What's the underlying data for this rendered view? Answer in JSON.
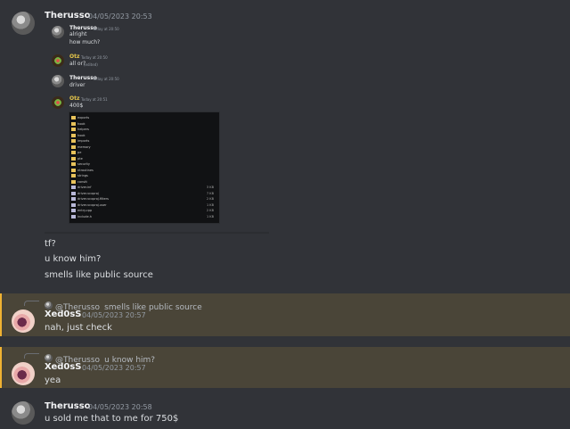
{
  "main_message": {
    "author": "Therusso",
    "timestamp": "04/05/2023 20:53"
  },
  "embedded_chat": [
    {
      "author": "Therusso",
      "time": "Today at 20:50",
      "lines": [
        "alright",
        "how much?"
      ]
    },
    {
      "author": "Otz",
      "time": "Today at 20:50",
      "lines": [
        "all or?"
      ],
      "edited": "(edited)"
    },
    {
      "author": "Therusso",
      "time": "Today at 20:50",
      "lines": [
        "driver"
      ]
    },
    {
      "author": "Otz",
      "time": "Today at 20:51",
      "lines": [
        "400$"
      ]
    }
  ],
  "file_list": [
    {
      "name": "exports",
      "type": "folder",
      "size": ""
    },
    {
      "name": "hook",
      "type": "folder",
      "size": ""
    },
    {
      "name": "helpers",
      "type": "folder",
      "size": ""
    },
    {
      "name": "hook",
      "type": "folder",
      "size": ""
    },
    {
      "name": "imports",
      "type": "folder",
      "size": ""
    },
    {
      "name": "memory",
      "type": "folder",
      "size": ""
    },
    {
      "name": "pe",
      "type": "folder",
      "size": ""
    },
    {
      "name": "pte",
      "type": "folder",
      "size": ""
    },
    {
      "name": "security",
      "type": "folder",
      "size": ""
    },
    {
      "name": "ntroutines",
      "type": "folder",
      "size": ""
    },
    {
      "name": "strings",
      "type": "folder",
      "size": ""
    },
    {
      "name": "constt",
      "type": "folder",
      "size": ""
    },
    {
      "name": "driver.inf",
      "type": "file",
      "size": "3 KB"
    },
    {
      "name": "driver.vcxproj",
      "type": "file",
      "size": "7 KB"
    },
    {
      "name": "driver.vcxproj.filters",
      "type": "file",
      "size": "2 KB"
    },
    {
      "name": "driver.vcxproj.user",
      "type": "file",
      "size": "1 KB"
    },
    {
      "name": "entry.cpp",
      "type": "file",
      "size": "2 KB"
    },
    {
      "name": "include.h",
      "type": "file",
      "size": "1 KB"
    }
  ],
  "followups": [
    "tf?",
    "u know him?",
    "smells like public source"
  ],
  "reply1": {
    "ref_author": "@Therusso",
    "ref_text": "smells like public source",
    "author": "Xed0sS",
    "timestamp": "04/05/2023 20:57",
    "text": "nah, just check"
  },
  "reply2": {
    "ref_author": "@Therusso",
    "ref_text": "u know him?",
    "author": "Xed0sS",
    "timestamp": "04/05/2023 20:57",
    "text": "yea"
  },
  "last_message": {
    "author": "Therusso",
    "timestamp": "04/05/2023 20:58",
    "text": "u sold me that to me for 750$"
  }
}
